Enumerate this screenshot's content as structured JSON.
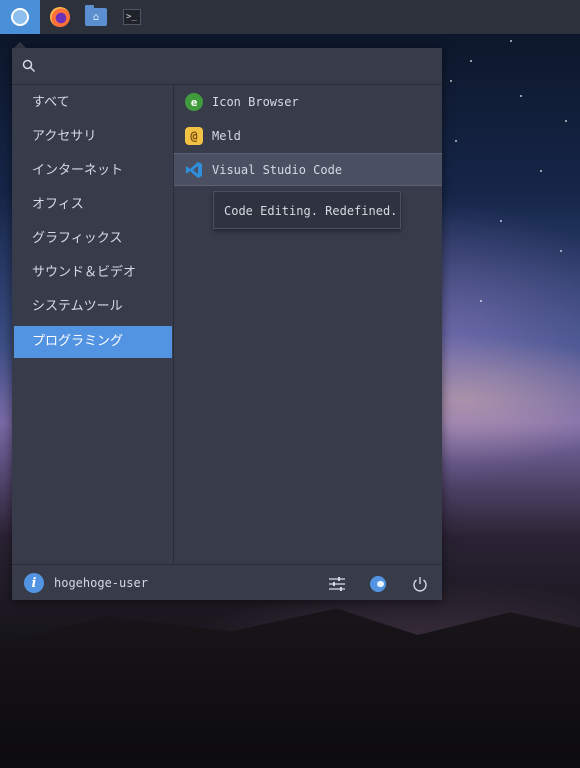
{
  "taskbar": {
    "items": [
      {
        "name": "whisker-menu",
        "icon": "menu-circle-icon"
      },
      {
        "name": "firefox",
        "icon": "firefox-icon"
      },
      {
        "name": "files",
        "icon": "folder-home-icon"
      },
      {
        "name": "terminal",
        "icon": "terminal-icon",
        "glyph": ">_"
      }
    ]
  },
  "search": {
    "placeholder": "",
    "value": ""
  },
  "categories": [
    {
      "label": "すべて",
      "active": false
    },
    {
      "label": "アクセサリ",
      "active": false
    },
    {
      "label": "インターネット",
      "active": false
    },
    {
      "label": "オフィス",
      "active": false
    },
    {
      "label": "グラフィックス",
      "active": false
    },
    {
      "label": "サウンド＆ビデオ",
      "active": false
    },
    {
      "label": "システムツール",
      "active": false
    },
    {
      "label": "プログラミング",
      "active": true
    }
  ],
  "apps": [
    {
      "label": "Icon Browser",
      "icon": "icon-browser-icon"
    },
    {
      "label": "Meld",
      "icon": "meld-icon"
    },
    {
      "label": "Visual Studio Code",
      "icon": "vscode-icon",
      "hovered": true
    }
  ],
  "tooltip": {
    "text": "Code Editing. Redefined."
  },
  "footer": {
    "username": "hogehoge-user"
  },
  "colors": {
    "accent": "#5294e2",
    "menu_bg": "#383c4a",
    "panel_bg": "#2c313c",
    "text": "#d3dae3"
  }
}
